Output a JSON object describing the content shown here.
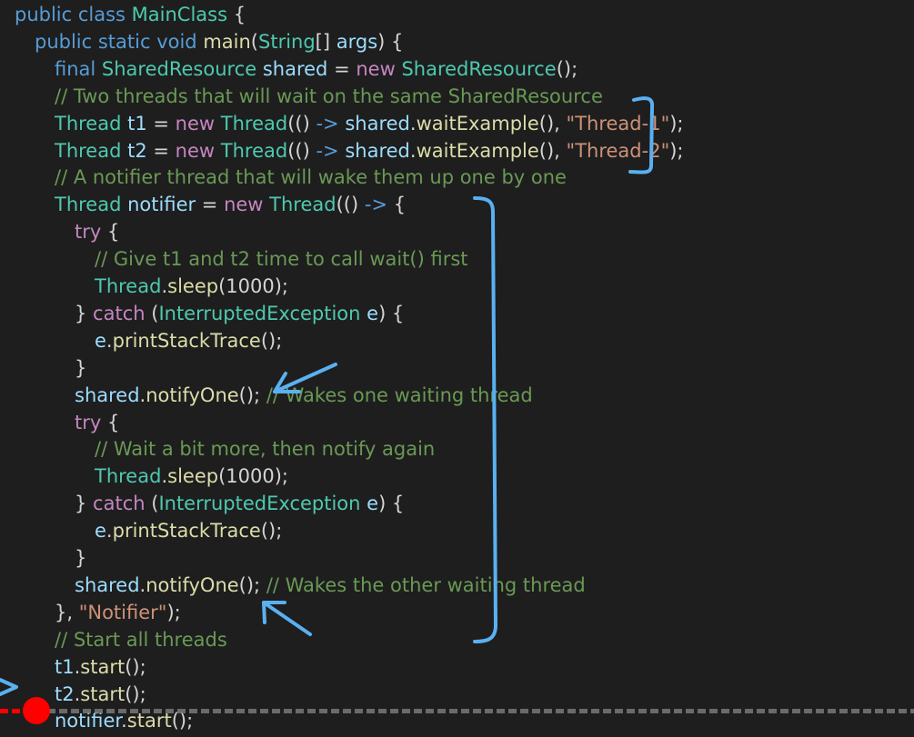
{
  "editor": {
    "lines": [
      [
        [
          "kw",
          "public class "
        ],
        [
          "typ",
          "MainClass"
        ],
        [
          "pun",
          " {"
        ]
      ],
      [
        [
          "kw",
          "public static void "
        ],
        [
          "fn",
          "main"
        ],
        [
          "pun",
          "("
        ],
        [
          "typ",
          "String"
        ],
        [
          "pun",
          "[] "
        ],
        [
          "var",
          "args"
        ],
        [
          "pun",
          ") {"
        ]
      ],
      [
        [
          "kw",
          "final "
        ],
        [
          "typ",
          "SharedResource "
        ],
        [
          "var",
          "shared"
        ],
        [
          "pun",
          " = "
        ],
        [
          "ctl",
          "new "
        ],
        [
          "typ",
          "SharedResource"
        ],
        [
          "pun",
          "();"
        ]
      ],
      [
        [
          "cmt",
          "// Two threads that will wait on the same SharedResource"
        ]
      ],
      [
        [
          "typ",
          "Thread "
        ],
        [
          "var",
          "t1"
        ],
        [
          "pun",
          " = "
        ],
        [
          "ctl",
          "new "
        ],
        [
          "typ",
          "Thread"
        ],
        [
          "pun",
          "(() "
        ],
        [
          "kw",
          "->"
        ],
        [
          "pun",
          " "
        ],
        [
          "var",
          "shared"
        ],
        [
          "pun",
          "."
        ],
        [
          "fn",
          "waitExample"
        ],
        [
          "pun",
          "(), "
        ],
        [
          "str",
          "\"Thread-1\""
        ],
        [
          "pun",
          ");"
        ]
      ],
      [
        [
          "typ",
          "Thread "
        ],
        [
          "var",
          "t2"
        ],
        [
          "pun",
          " = "
        ],
        [
          "ctl",
          "new "
        ],
        [
          "typ",
          "Thread"
        ],
        [
          "pun",
          "(() "
        ],
        [
          "kw",
          "->"
        ],
        [
          "pun",
          " "
        ],
        [
          "var",
          "shared"
        ],
        [
          "pun",
          "."
        ],
        [
          "fn",
          "waitExample"
        ],
        [
          "pun",
          "(), "
        ],
        [
          "str",
          "\"Thread-2\""
        ],
        [
          "pun",
          ");"
        ]
      ],
      [
        [
          "cmt",
          "// A notifier thread that will wake them up one by one"
        ]
      ],
      [
        [
          "typ",
          "Thread "
        ],
        [
          "var",
          "notifier"
        ],
        [
          "pun",
          " = "
        ],
        [
          "ctl",
          "new "
        ],
        [
          "typ",
          "Thread"
        ],
        [
          "pun",
          "(() "
        ],
        [
          "kw",
          "->"
        ],
        [
          "pun",
          " {"
        ]
      ],
      [
        [
          "ctl",
          "try"
        ],
        [
          "pun",
          " {"
        ]
      ],
      [
        [
          "cmt",
          "// Give t1 and t2 time to call wait() first"
        ]
      ],
      [
        [
          "typ",
          "Thread"
        ],
        [
          "pun",
          "."
        ],
        [
          "fn",
          "sleep"
        ],
        [
          "pun",
          "(1000);"
        ]
      ],
      [
        [
          "pun",
          "} "
        ],
        [
          "ctl",
          "catch"
        ],
        [
          "pun",
          " ("
        ],
        [
          "typ",
          "InterruptedException "
        ],
        [
          "var",
          "e"
        ],
        [
          "pun",
          ") {"
        ]
      ],
      [
        [
          "var",
          "e"
        ],
        [
          "pun",
          "."
        ],
        [
          "fn",
          "printStackTrace"
        ],
        [
          "pun",
          "();"
        ]
      ],
      [
        [
          "pun",
          "}"
        ]
      ],
      [
        [
          "var",
          "shared"
        ],
        [
          "pun",
          "."
        ],
        [
          "fn",
          "notifyOne"
        ],
        [
          "pun",
          "(); "
        ],
        [
          "cmt",
          "// Wakes one waiting thread"
        ]
      ],
      [
        [
          "ctl",
          "try"
        ],
        [
          "pun",
          " {"
        ]
      ],
      [
        [
          "cmt",
          "// Wait a bit more, then notify again"
        ]
      ],
      [
        [
          "typ",
          "Thread"
        ],
        [
          "pun",
          "."
        ],
        [
          "fn",
          "sleep"
        ],
        [
          "pun",
          "(1000);"
        ]
      ],
      [
        [
          "pun",
          "} "
        ],
        [
          "ctl",
          "catch"
        ],
        [
          "pun",
          " ("
        ],
        [
          "typ",
          "InterruptedException "
        ],
        [
          "var",
          "e"
        ],
        [
          "pun",
          ") {"
        ]
      ],
      [
        [
          "var",
          "e"
        ],
        [
          "pun",
          "."
        ],
        [
          "fn",
          "printStackTrace"
        ],
        [
          "pun",
          "();"
        ]
      ],
      [
        [
          "pun",
          "}"
        ]
      ],
      [
        [
          "var",
          "shared"
        ],
        [
          "pun",
          "."
        ],
        [
          "fn",
          "notifyOne"
        ],
        [
          "pun",
          "(); "
        ],
        [
          "cmt",
          "// Wakes the other waiting thread"
        ]
      ],
      [
        [
          "pun",
          "}, "
        ],
        [
          "str",
          "\"Notifier\""
        ],
        [
          "pun",
          ");"
        ]
      ],
      [
        [
          "cmt",
          "// Start all threads"
        ]
      ],
      [
        [
          "var",
          "t1"
        ],
        [
          "pun",
          "."
        ],
        [
          "fn",
          "start"
        ],
        [
          "pun",
          "();"
        ]
      ],
      [
        [
          "var",
          "t2"
        ],
        [
          "pun",
          "."
        ],
        [
          "fn",
          "start"
        ],
        [
          "pun",
          "();"
        ]
      ],
      [
        [
          "var",
          "notifier"
        ],
        [
          "pun",
          "."
        ],
        [
          "fn",
          "start"
        ],
        [
          "pun",
          "();"
        ]
      ]
    ]
  },
  "colors": {
    "background": "#1e1e1e",
    "keyword": "#569cd6",
    "control": "#c586c0",
    "type": "#4ec9b0",
    "function": "#dcdcaa",
    "variable": "#9cdcfe",
    "string": "#ce9178",
    "comment": "#6a9955",
    "annotation": "#5ab0f0",
    "progress": "#ff0000"
  },
  "player": {
    "progress_fraction": 0.04
  }
}
